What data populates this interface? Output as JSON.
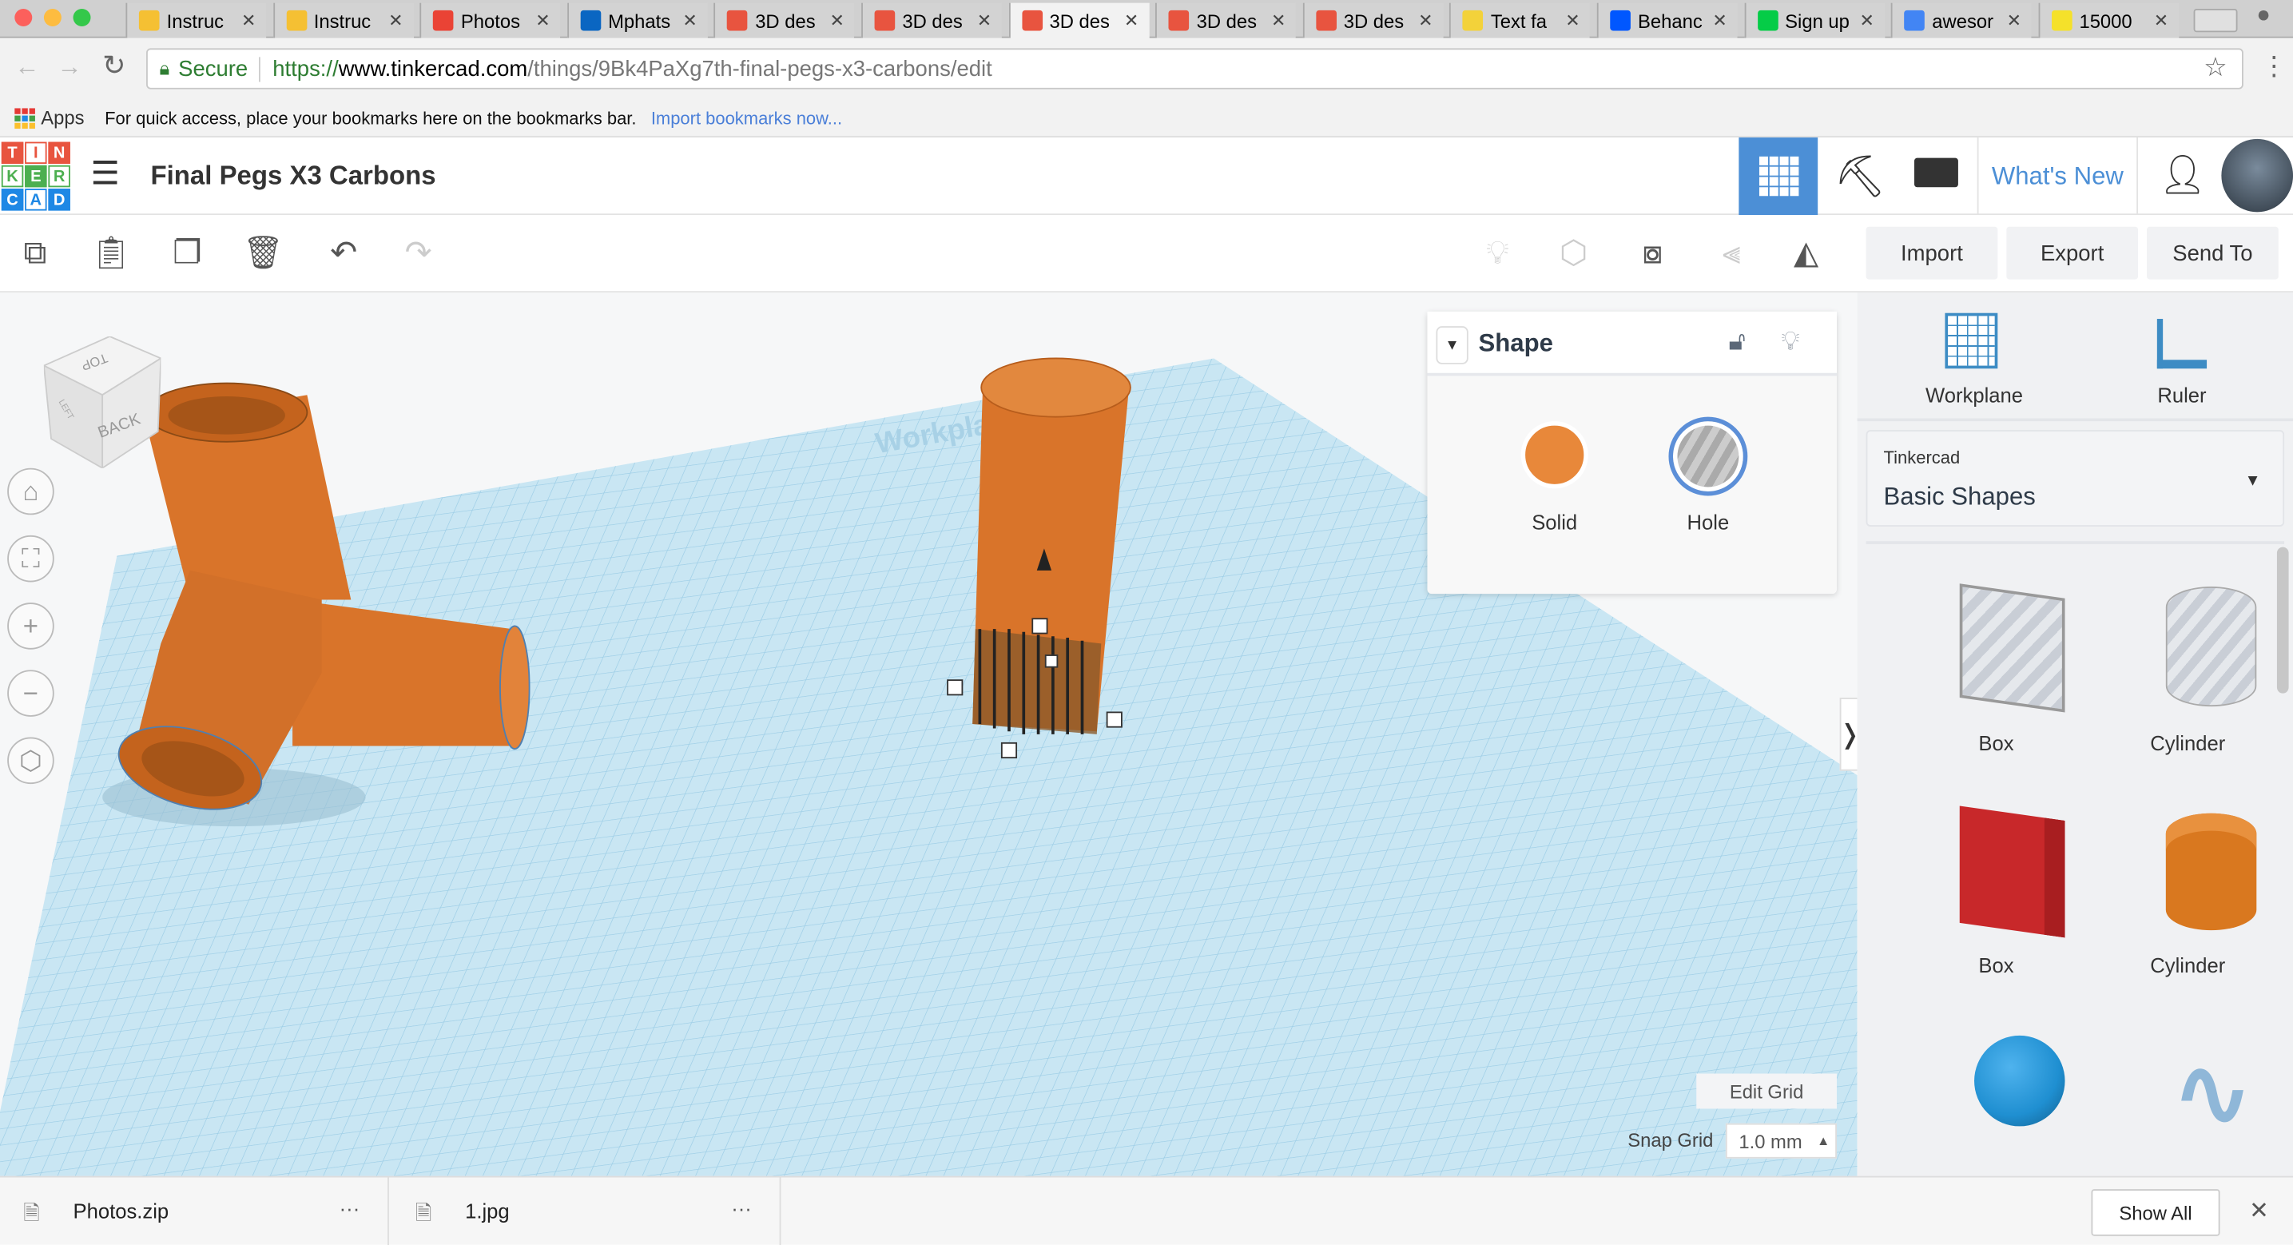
{
  "browser": {
    "tabs": [
      {
        "title": "Instruc",
        "icon": "instructables-robot-icon",
        "color": "#f5c033"
      },
      {
        "title": "Instruc",
        "icon": "instructables-robot-icon",
        "color": "#f5c033"
      },
      {
        "title": "Photos",
        "icon": "google-photos-icon",
        "color": "#ea4335"
      },
      {
        "title": "Mphats",
        "icon": "linkedin-icon",
        "color": "#0a66c2"
      },
      {
        "title": "3D des",
        "icon": "tinkercad-icon",
        "color": "#e8543f"
      },
      {
        "title": "3D des",
        "icon": "tinkercad-icon",
        "color": "#e8543f"
      },
      {
        "title": "3D des",
        "icon": "tinkercad-icon",
        "color": "#e8543f",
        "active": true
      },
      {
        "title": "3D des",
        "icon": "tinkercad-icon",
        "color": "#e8543f"
      },
      {
        "title": "3D des",
        "icon": "tinkercad-icon",
        "color": "#e8543f"
      },
      {
        "title": "Text fa",
        "icon": "awesome-face-icon",
        "color": "#f3d23a"
      },
      {
        "title": "Behanc",
        "icon": "behance-icon",
        "color": "#0057ff"
      },
      {
        "title": "Sign up",
        "icon": "deviantart-icon",
        "color": "#05cc47"
      },
      {
        "title": "awesor",
        "icon": "google-icon",
        "color": "#4285f4"
      },
      {
        "title": "15000",
        "icon": "smiley-icon",
        "color": "#f5e12a"
      }
    ],
    "secure_label": "Secure",
    "url_scheme": "https://",
    "url_host": "www.tinkercad.com",
    "url_path": "/things/9Bk4PaXg7th-final-pegs-x3-carbons/edit",
    "apps_label": "Apps",
    "bookmarks_hint": "For quick access, place your bookmarks here on the bookmarks bar.",
    "import_bookmarks": "Import bookmarks now..."
  },
  "app": {
    "logo_letters": [
      "T",
      "I",
      "N",
      "K",
      "E",
      "R",
      "C",
      "A",
      "D"
    ],
    "design_title": "Final Pegs X3 Carbons",
    "whats_new": "What's New",
    "import": "Import",
    "export": "Export",
    "send_to": "Send To"
  },
  "viewcube": {
    "top": "TOP",
    "back": "BACK",
    "left": "LEFT"
  },
  "workplane_text": "Workplane",
  "shape_panel": {
    "title": "Shape",
    "solid": "Solid",
    "hole": "Hole",
    "solid_color": "#e8883a"
  },
  "sidebar": {
    "workplane": "Workplane",
    "ruler": "Ruler",
    "library_source": "Tinkercad",
    "library": "Basic Shapes",
    "shapes": [
      {
        "label": "Box",
        "kind": "hole-box"
      },
      {
        "label": "Cylinder",
        "kind": "hole-cylinder"
      },
      {
        "label": "Box",
        "kind": "box",
        "color": "#c8282a"
      },
      {
        "label": "Cylinder",
        "kind": "cylinder",
        "color": "#d9781f"
      },
      {
        "label": "",
        "kind": "sphere",
        "color": "#1f8fd1"
      },
      {
        "label": "",
        "kind": "scribble",
        "color": "#8fb7d8"
      }
    ]
  },
  "grid": {
    "edit_grid": "Edit Grid",
    "snap_grid_label": "Snap Grid",
    "snap_value": "1.0 mm"
  },
  "downloads": {
    "items": [
      "Photos.zip",
      "1.jpg"
    ],
    "show_all": "Show All"
  }
}
